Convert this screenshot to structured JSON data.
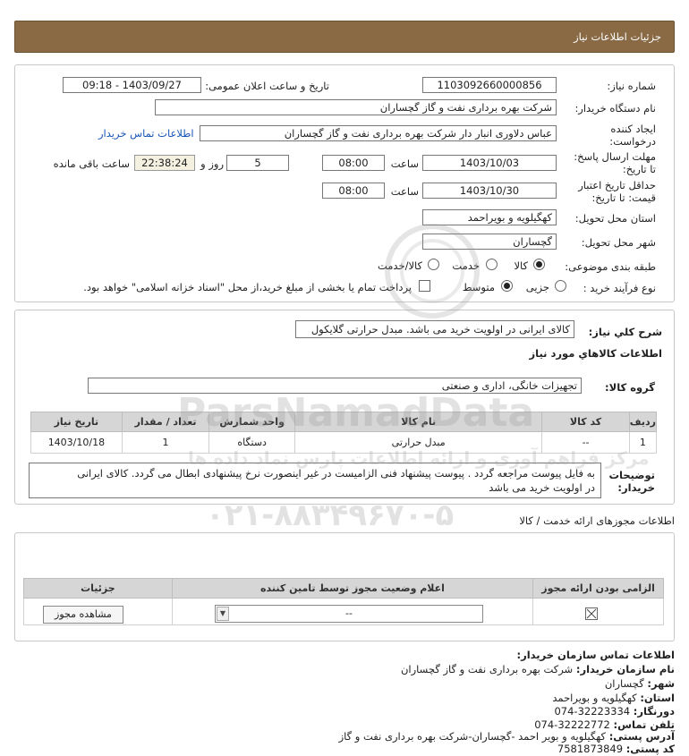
{
  "header": {
    "title": "جزئیات اطلاعات نیاز"
  },
  "form": {
    "need_number_label": "شماره نیاز:",
    "need_number": "1103092660000856",
    "announce_label": "تاریخ و ساعت اعلان عمومی:",
    "announce_value": "1403/09/27 - 09:18",
    "buyer_label": "نام دستگاه خریدار:",
    "buyer_value": "شرکت بهره برداری نفت و گاز گچساران",
    "creator_label_1": "ایجاد کننده",
    "creator_label_2": "درخواست:",
    "creator_value": "عباس دلاوری انبار دار شرکت بهره برداری نفت و گاز گچساران",
    "contact_link": "اطلاعات تماس خریدار",
    "deadline_label_1": "مهلت ارسال پاسخ:",
    "deadline_label_2": "تا تاریخ:",
    "deadline_date": "1403/10/03",
    "time_label": "ساعت",
    "deadline_time": "08:00",
    "days_value": "5",
    "days_label": "روز و",
    "remaining_time": "22:38:24",
    "remaining_label": "ساعت باقی مانده",
    "validity_label_1": "حداقل تاریخ اعتبار",
    "validity_label_2": "قیمت: تا تاریخ:",
    "validity_date": "1403/10/30",
    "validity_time": "08:00",
    "province_label": "استان محل تحویل:",
    "province_value": "کهگیلویه و بویراحمد",
    "city_label": "شهر محل تحویل:",
    "city_value": "گچساران",
    "category_label": "طبقه بندی موضوعی:",
    "category_options": [
      "کالا",
      "خدمت",
      "کالا/خدمت"
    ],
    "process_label": "نوع فرآیند خرید :",
    "process_options": [
      "جزیی",
      "متوسط"
    ],
    "payment_note": "پرداخت تمام یا بخشی از مبلغ خرید،از محل \"اسناد خزانه اسلامی\" خواهد بود."
  },
  "description": {
    "label": "شرح کلي نياز:",
    "value": "کالای ایرانی در اولویت خرید می باشد. مبدل حرارتی گلایکول"
  },
  "goods": {
    "section_title": "اطلاعات کالاهاي مورد نياز",
    "group_label": "گروه کالا:",
    "group_value": "تجهیزات خانگی، اداری و صنعتی",
    "columns": [
      "ردیف",
      "کد کالا",
      "نام کالا",
      "واحد شمارش",
      "تعداد / مقدار",
      "تاریخ نیاز"
    ],
    "rows": [
      [
        "1",
        "--",
        "مبدل حرارتی",
        "دستگاه",
        "1",
        "1403/10/18"
      ]
    ]
  },
  "buyer_notes": {
    "label_1": "توضیحات",
    "label_2": "خریدار:",
    "line_1": "به فایل پیوست مراجعه گردد . پیوست پیشنهاد فنی الزامیست در غیر اینصورت نرخ پیشنهادی ابطال می گردد. کالای ایرانی",
    "line_2": "در اولویت خرید می باشد"
  },
  "permits": {
    "section_title": "اطلاعات مجوزهای ارائه خدمت / کالا",
    "columns": [
      "الزامی بودن ارائه مجوز",
      "اعلام وضعیت مجوز توسط تامین کننده",
      "جزئیات"
    ],
    "select_value": "--",
    "view_button": "مشاهده مجوز"
  },
  "contact": {
    "title": "اطلاعات تماس سازمان خریدار:",
    "org_label": "نام سازمان خریدار:",
    "org_value": "شرکت بهره برداری نفت و گاز گچساران",
    "city_label": "شهر:",
    "city_value": "گچساران",
    "province_label": "استان:",
    "province_value": "کهگیلویه و بویراحمد",
    "fax_label": "دورنگار:",
    "fax_value": "074-32223334",
    "phone_label": "تلفن تماس:",
    "phone_value": "074-32222772",
    "address_label": "آدرس پستی:",
    "address_value": "کهگیلویه و بویر احمد -گچساران-شرکت بهره برداری نفت و گاز",
    "postal_label": "کد پستی:",
    "postal_value": "7581873849"
  },
  "watermark": {
    "brand": "ParsNamadData",
    "phone": "۰۲۱-۸۸۳۴۹۶۷۰-۵",
    "tagline": "مرکز فراهم آوری و ارائه اطلاعات پارس نماد داده ها"
  }
}
